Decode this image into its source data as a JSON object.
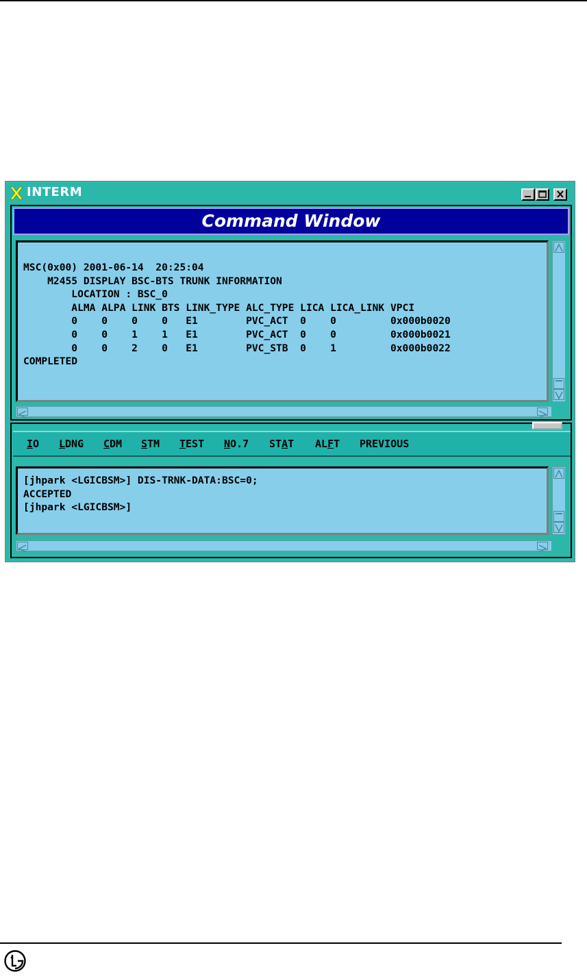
{
  "window": {
    "title": "INTERM",
    "banner": "Command Window"
  },
  "output": {
    "lines": [
      "MSC(0x00) 2001-06-14  20:25:04",
      "    M2455 DISPLAY BSC-BTS TRUNK INFORMATION",
      "        LOCATION : BSC_0",
      "        ALMA ALPA LINK BTS LINK_TYPE ALC_TYPE LICA LICA_LINK VPCI",
      "        0    0    0    0   E1        PVC_ACT  0    0         0x000b0020",
      "        0    0    1    1   E1        PVC_ACT  0    0         0x000b0021",
      "        0    0    2    0   E1        PVC_STB  0    1         0x000b0022",
      "COMPLETED"
    ]
  },
  "menu": {
    "items": [
      {
        "pre": "",
        "key": "I",
        "post": "O"
      },
      {
        "pre": "",
        "key": "L",
        "post": "DNG"
      },
      {
        "pre": "",
        "key": "C",
        "post": "DM"
      },
      {
        "pre": "",
        "key": "S",
        "post": "TM"
      },
      {
        "pre": "",
        "key": "T",
        "post": "EST"
      },
      {
        "pre": "",
        "key": "N",
        "post": "O.7"
      },
      {
        "pre": "ST",
        "key": "A",
        "post": "T"
      },
      {
        "pre": "AL",
        "key": "F",
        "post": "T"
      },
      {
        "pre": "PREVIOUS",
        "key": "",
        "post": ""
      }
    ]
  },
  "input": {
    "lines": [
      "[jhpark <LGICBSM>] DIS-TRNK-DATA:BSC=0;",
      "ACCEPTED",
      "[jhpark <LGICBSM>]"
    ]
  },
  "colors": {
    "frame": "#2cb7ab",
    "banner": "#00009a",
    "text_area": "#87ceeb"
  }
}
